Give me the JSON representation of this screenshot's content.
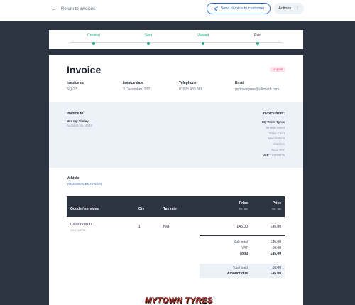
{
  "topbar": {
    "back_label": "Return to invoices",
    "send_label": "Send invoice to customer",
    "actions_label": "Actions"
  },
  "progress": {
    "steps": [
      {
        "label": "Created"
      },
      {
        "label": "Sent"
      },
      {
        "label": "Viewed"
      },
      {
        "label": "Paid"
      }
    ]
  },
  "invoice": {
    "title": "Invoice",
    "status": "Unpaid",
    "meta": [
      {
        "label": "Invoice no",
        "value": "SQ-27"
      },
      {
        "label": "Invoice date",
        "value": "3 December, 2021"
      },
      {
        "label": "Telephone",
        "value": "01625 433 388"
      },
      {
        "label": "Email",
        "value": "mytowntyres@silkmoth.com"
      }
    ],
    "to": {
      "label": "Invoice to:",
      "name": "Mrs Ivy Tilsley",
      "account": "Account No. 4683"
    },
    "from": {
      "label": "Invoice from:",
      "name": "My Town Tyres",
      "address": [
        "38 High Street",
        "Stoke Court",
        "Macclesfield",
        "Cheshire",
        "SK11 6AY"
      ],
      "vat_label": "VAT:",
      "vat_value": "123456678"
    },
    "vehicle": {
      "label": "Vehicle",
      "value": "VOLKSWAGEN PASSAT"
    },
    "table": {
      "headers": {
        "goods": "Goods / services",
        "qty": "Qty",
        "tax": "Tax rate",
        "price_ex": "Price",
        "price_ex_sub": "Ex. tax",
        "price_inc": "Price",
        "price_inc_sub": "Inc. tax"
      },
      "rows": [
        {
          "desc": "Class IV MOT",
          "sub": "SKU: MOT4",
          "qty": "1",
          "tax": "N/A",
          "price_ex": "£45.00",
          "price_inc": "£45.00"
        }
      ]
    },
    "totals": {
      "subtotal_label": "Sub-total",
      "subtotal_value": "£45.00",
      "vat_label": "VAT",
      "vat_value": "£0.00",
      "total_label": "Total",
      "total_value": "£45.00",
      "paid_label": "Total paid",
      "paid_value": "£0.00",
      "due_label": "Amount due",
      "due_value": "£45.00"
    },
    "logo_text": "MYTOWN TYRES"
  }
}
